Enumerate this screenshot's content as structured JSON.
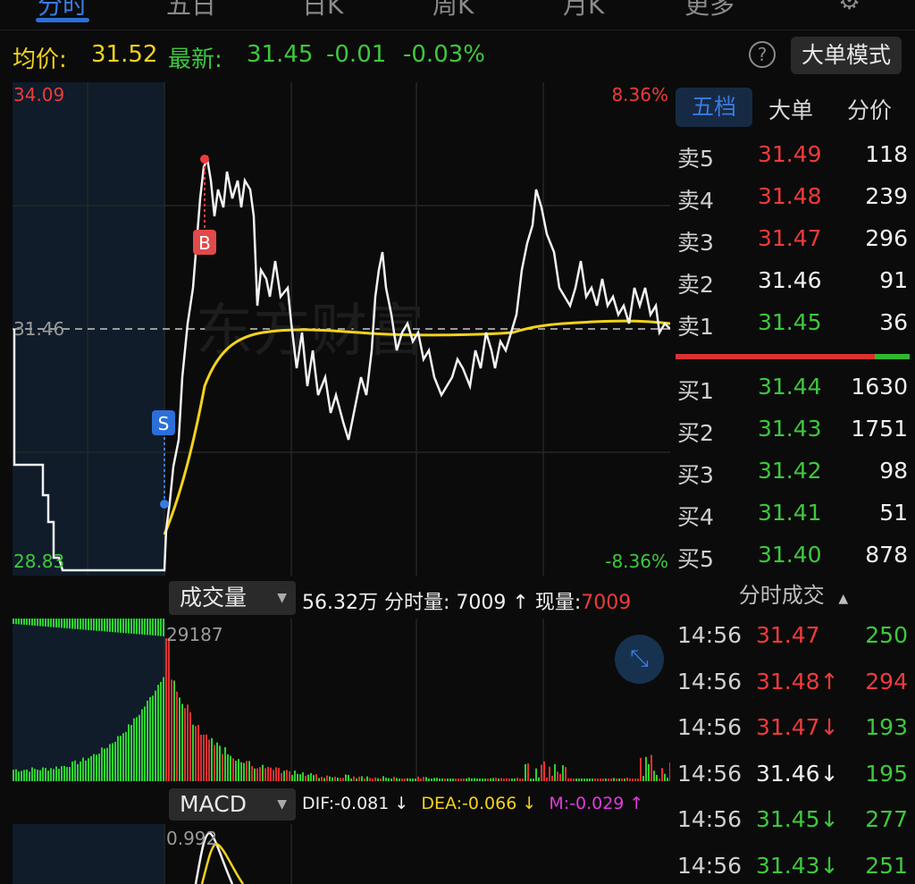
{
  "nav": {
    "tabs": [
      "分时",
      "五日",
      "日K",
      "周K",
      "月K",
      "更多"
    ]
  },
  "info": {
    "avg_label": "均价:",
    "avg_value": "31.52",
    "latest_label": "最新:",
    "latest_value": "31.45",
    "change": "-0.01",
    "change_pct": "-0.03%",
    "help_icon": "question-icon",
    "mode_button": "大单模式"
  },
  "price_chart": {
    "y_max": "34.09",
    "y_min": "28.83",
    "y_ref": "31.46",
    "pct_max": "8.36%",
    "pct_min": "-8.36%",
    "markers": {
      "sell": "S",
      "buy": "B"
    },
    "watermark": "东方财富"
  },
  "orderbook": {
    "tabs": [
      "五档",
      "大单",
      "分价"
    ],
    "asks": [
      {
        "label": "卖5",
        "price": "31.49",
        "vol": "118",
        "color": "red"
      },
      {
        "label": "卖4",
        "price": "31.48",
        "vol": "239",
        "color": "red"
      },
      {
        "label": "卖3",
        "price": "31.47",
        "vol": "296",
        "color": "red"
      },
      {
        "label": "卖2",
        "price": "31.46",
        "vol": "91",
        "color": "white"
      },
      {
        "label": "卖1",
        "price": "31.45",
        "vol": "36",
        "color": "green"
      }
    ],
    "bids": [
      {
        "label": "买1",
        "price": "31.44",
        "vol": "1630",
        "color": "green"
      },
      {
        "label": "买2",
        "price": "31.43",
        "vol": "1751",
        "color": "green"
      },
      {
        "label": "买3",
        "price": "31.42",
        "vol": "98",
        "color": "green"
      },
      {
        "label": "买4",
        "price": "31.41",
        "vol": "51",
        "color": "green"
      },
      {
        "label": "买5",
        "price": "31.40",
        "vol": "878",
        "color": "green"
      }
    ],
    "buy_sell_ratio": 0.85
  },
  "volume": {
    "selector": "成交量",
    "total": "56.32万",
    "minute_label": "分时量:",
    "minute_value": "7009",
    "arrow": "↑",
    "current_label": "现量:",
    "current_value": "7009",
    "peak": "29187",
    "expand_icon": "expand-arrows-icon"
  },
  "macd": {
    "selector": "MACD",
    "dif": "DIF:-0.081",
    "dif_arrow": "↓",
    "dea": "DEA:-0.066",
    "dea_arrow": "↓",
    "m": "M:-0.029",
    "m_arrow": "↑",
    "top_value": "0.992"
  },
  "ticks": {
    "header": "分时成交",
    "rows": [
      {
        "time": "14:56",
        "price": "31.47",
        "arrow": "",
        "vol": "250",
        "pcolor": "red",
        "vcolor": "green"
      },
      {
        "time": "14:56",
        "price": "31.48",
        "arrow": "↑",
        "vol": "294",
        "pcolor": "red",
        "vcolor": "red"
      },
      {
        "time": "14:56",
        "price": "31.47",
        "arrow": "↓",
        "vol": "193",
        "pcolor": "red",
        "vcolor": "green"
      },
      {
        "time": "14:56",
        "price": "31.46",
        "arrow": "↓",
        "vol": "195",
        "pcolor": "white",
        "vcolor": "green"
      },
      {
        "time": "14:56",
        "price": "31.45",
        "arrow": "↓",
        "vol": "277",
        "pcolor": "green",
        "vcolor": "green"
      },
      {
        "time": "14:56",
        "price": "31.43",
        "arrow": "↓",
        "vol": "251",
        "pcolor": "green",
        "vcolor": "green"
      }
    ]
  },
  "colors": {
    "up": "#ef3b3b",
    "down": "#3ec83e",
    "avg_line": "#f2d21b",
    "accent": "#3a7be0"
  }
}
